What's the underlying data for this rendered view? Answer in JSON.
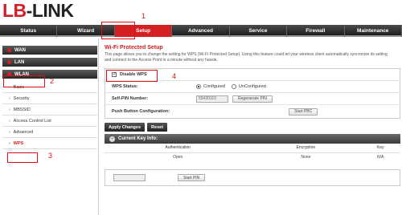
{
  "brand": {
    "first": "LB",
    "dash": "-",
    "rest": "LINK"
  },
  "annotations": [
    "1",
    "2",
    "3",
    "4"
  ],
  "nav": [
    "Status",
    "Wizard",
    "Setup",
    "Advanced",
    "Service",
    "Firewall",
    "Maintenance"
  ],
  "sidebar": {
    "groups": [
      "WAN",
      "LAN",
      "WLAN"
    ],
    "items": [
      "Basic",
      "Security",
      "MBSSID",
      "Access Control List",
      "Advanced",
      "WPS"
    ]
  },
  "content": {
    "title": "Wi-Fi Protected Setup",
    "description": "This page allows you to change the setting for WPS (Wi-Fi Protected Setup). Using this feature could let your wireless client automatically syncronize its setting and connect to the Access Point in a minute without any hassle.",
    "disable_wps_label": "Disable WPS",
    "wps_status_label": "WPS Status:",
    "configured_label": "Configured",
    "unconfigured_label": "UnConfigured",
    "self_pin_label": "Self-PIN Number:",
    "self_pin_value": "55430110",
    "regenerate_pin_label": "Regenerate PIN",
    "push_button_label": "Push Button Configuration:",
    "start_pbc_label": "Start PBC",
    "apply_label": "Apply Changes",
    "reset_label": "Reset",
    "key_info_title": "Current Key Info:",
    "key_headers": [
      "Authentication",
      "Encryption",
      "Key"
    ],
    "key_row": [
      "Open",
      "None",
      "N/A"
    ],
    "start_pin_label": "Start PIN"
  }
}
